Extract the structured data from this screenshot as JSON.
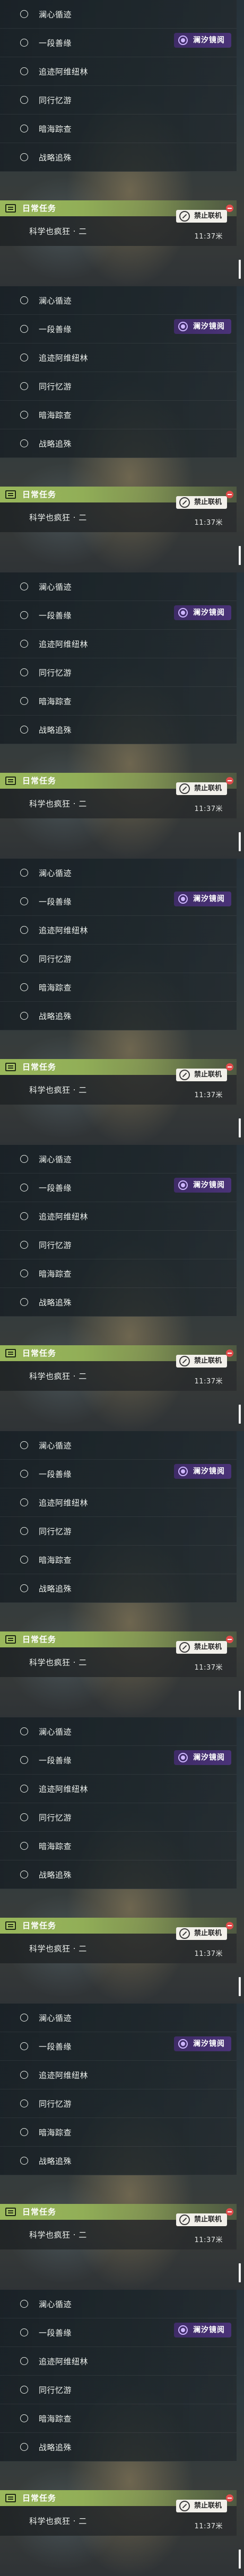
{
  "panel_count": 9,
  "quests": [
    "澜心循迹",
    "一段善缘",
    "追迹阿维纽林",
    "同行忆游",
    "暗海踪查",
    "战略追殊"
  ],
  "featured_tag": "澜汐镜阅",
  "daily": {
    "title": "日常任务",
    "task_label": "科学也疯狂 · 二",
    "status_tag": "禁止联机",
    "time": "11:37米"
  },
  "colors": {
    "daily_accent": "#9ab85c",
    "tag_purple": "#4a3378",
    "lock_red": "#e14b4b"
  }
}
